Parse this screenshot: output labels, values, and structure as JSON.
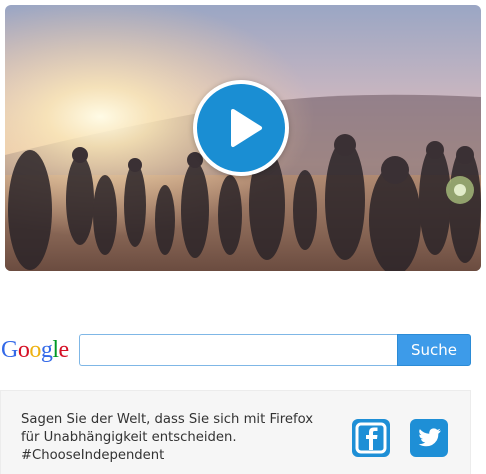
{
  "video": {
    "thumbnail": "crowd-dancing-desert-sunset",
    "play_icon": "play-icon",
    "accent_color": "#1a8ed3"
  },
  "search": {
    "logo_letters": [
      "G",
      "o",
      "o",
      "g",
      "l",
      "e"
    ],
    "input_value": "",
    "button_label": "Suche"
  },
  "share": {
    "lines": [
      "Sagen Sie der Welt, dass Sie sich mit Firefox",
      "für Unabhängigkeit entscheiden.",
      "#ChooseIndependent"
    ],
    "facebook_icon": "facebook-icon",
    "twitter_icon": "twitter-icon",
    "icon_color": "#1e8fd6"
  }
}
